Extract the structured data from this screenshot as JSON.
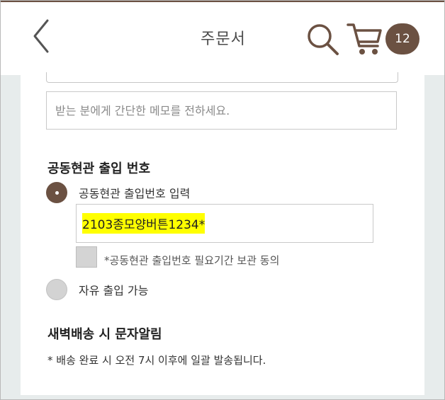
{
  "header": {
    "title": "주문서",
    "cart_count": "12",
    "brand_color": "#6b5142"
  },
  "delivery_memo": {
    "placeholder": "받는 분에게 간단한 메모를 전하세요."
  },
  "entrance": {
    "section_title": "공동현관 출입 번호",
    "option_code_label": "공동현관 출입번호 입력",
    "option_code_selected": true,
    "code_value": "2103종모양버튼1234*",
    "consent_label": "*공동현관 출입번호 필요기간 보관 동의",
    "option_free_label": "자유 출입 가능"
  },
  "dawn_notice": {
    "section_title": "새벽배송 시 문자알림",
    "notice_text": "* 배송 완료 시 오전 7시 이후에 일괄 발송됩니다."
  },
  "icons": {
    "back": "chevron-left-icon",
    "search": "search-icon",
    "cart": "cart-icon"
  }
}
